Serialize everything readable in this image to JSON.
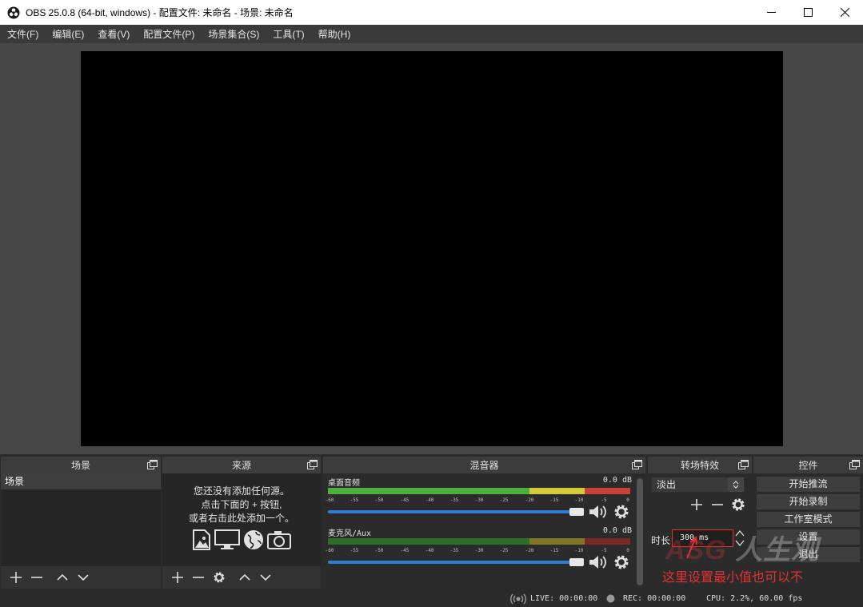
{
  "window": {
    "title": "OBS 25.0.8 (64-bit, windows) - 配置文件: 未命名 - 场景: 未命名",
    "minimize": "─",
    "maximize": "☐",
    "close": "✕"
  },
  "menu": [
    "文件(F)",
    "编辑(E)",
    "查看(V)",
    "配置文件(P)",
    "场景集合(S)",
    "工具(T)",
    "帮助(H)"
  ],
  "docks": {
    "scenes": {
      "title": "场景",
      "items": [
        "场景"
      ]
    },
    "sources": {
      "title": "来源",
      "empty_line1": "您还没有添加任何源。",
      "empty_line2": "点击下面的 + 按钮,",
      "empty_line3": "或者右击此处添加一个。"
    },
    "mixer": {
      "title": "混音器",
      "channels": [
        {
          "name": "桌面音频",
          "db": "0.0 dB"
        },
        {
          "name": "麦克风/Aux",
          "db": "0.0 dB"
        }
      ],
      "ticks": [
        "-60",
        "-55",
        "-50",
        "-45",
        "-40",
        "-35",
        "-30",
        "-25",
        "-20",
        "-15",
        "-10",
        "-5",
        "0"
      ]
    },
    "transitions": {
      "title": "转场特效",
      "selected": "淡出",
      "duration_label": "时长",
      "duration_value": "300 ms"
    },
    "controls": {
      "title": "控件",
      "buttons": [
        "开始推流",
        "开始录制",
        "工作室模式",
        "设置",
        "退出"
      ]
    }
  },
  "status": {
    "live": "LIVE: 00:00:00",
    "rec": "REC: 00:00:00",
    "cpu": "CPU: 2.2%, 60.00 fps"
  },
  "annotation": "这里设置最小值也可以不",
  "watermark": {
    "left": "ASG",
    "right": "人生观"
  },
  "colors": {
    "accent": "#2f7fd4",
    "annotation": "#e53030",
    "meter_green": "#4caf3c",
    "meter_yellow": "#d4c93d",
    "meter_red": "#c7403a"
  }
}
